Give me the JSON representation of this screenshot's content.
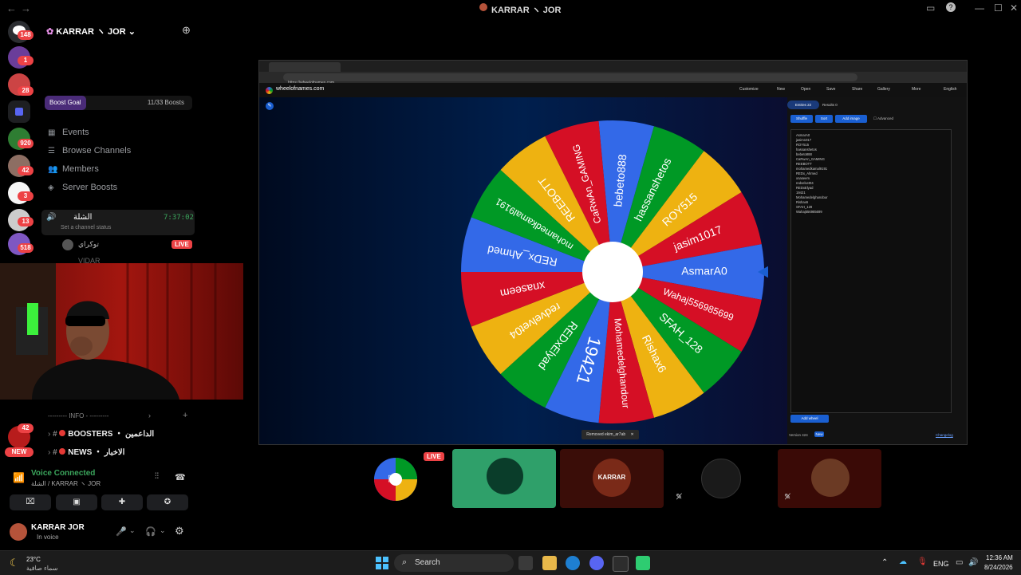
{
  "window": {
    "title": "KARRAR ヽ JOR",
    "back": "←",
    "forward": "→"
  },
  "servers": {
    "badges": [
      "148",
      "1",
      "28",
      "920",
      "42",
      "3",
      "13",
      "518",
      "42"
    ],
    "new_label": "NEW"
  },
  "sidebar": {
    "server_name": "KARRAR ヽ JOR",
    "boost": {
      "label": "Boost Goal",
      "count": "11/33 Boosts"
    },
    "menu": [
      {
        "icon": "calendar-icon",
        "label": "Events"
      },
      {
        "icon": "browse-icon",
        "label": "Browse Channels"
      },
      {
        "icon": "members-icon",
        "label": "Members"
      },
      {
        "icon": "boost-icon",
        "label": "Server Boosts"
      }
    ],
    "voice_channel": {
      "name": "الشلة",
      "timer": "7:37:02",
      "status": "Set a channel status"
    },
    "voice_users": [
      {
        "name": "توكراي",
        "live": "LIVE"
      },
      {
        "name": "VIDAR"
      }
    ],
    "category": "--------- INFO - ---------",
    "channels": [
      {
        "name": "BOOSTERS ・ الداعمين"
      },
      {
        "name": "NEWS ・ الاخبار"
      }
    ]
  },
  "voice_connected": {
    "title": "Voice Connected",
    "subtitle": "الشلة / KARRAR ヽ JOR"
  },
  "user": {
    "name": "KARRAR JOR",
    "status": "In voice"
  },
  "share": {
    "url": "https://wheelofnames.com",
    "site": "wheelofnames.com",
    "toolbar": [
      "Customize",
      "New",
      "Open",
      "Save",
      "Share",
      "Gallery",
      "More",
      "English"
    ],
    "tabs": {
      "entries": "Entries",
      "entries_count": "22",
      "results": "Results",
      "results_count": "0"
    },
    "buttons": {
      "shuffle": "Shuffle",
      "sort": "Sort",
      "add_image": "Add image",
      "advanced": "Advanced",
      "add_wheel": "Add wheel"
    },
    "entries": [
      "AsmarA0",
      "jasim1017",
      "ROY515",
      "hassanshetos",
      "bebeto888",
      "CaRwAn_GAMING",
      "REEBOTT",
      "mohamedkamal9191",
      "REDx_Ahmed",
      "xnaseem",
      "redvelvet04",
      "REDxElyad",
      "19421",
      "Mohamedelghandour",
      "Rishax6",
      "SFAH_128",
      "Wahaj556985699"
    ],
    "version": "Version 424",
    "version_tag": "New",
    "changelog": "Changelog",
    "toast": "Removed ekim_ar7ab",
    "wheel_segments": [
      {
        "label": "bebeto888",
        "color": "#3369e8"
      },
      {
        "label": "hassanshetos",
        "color": "#009925"
      },
      {
        "label": "ROY515",
        "color": "#eeb211"
      },
      {
        "label": "jasim1017",
        "color": "#d50f25"
      },
      {
        "label": "AsmarA0",
        "color": "#3369e8"
      },
      {
        "label": "Wahaj556985699",
        "color": "#d50f25"
      },
      {
        "label": "SFAH_128",
        "color": "#009925"
      },
      {
        "label": "Rishax6",
        "color": "#eeb211"
      },
      {
        "label": "Mohamedelghandour",
        "color": "#d50f25"
      },
      {
        "label": "19421",
        "color": "#3369e8"
      },
      {
        "label": "REDxElyad",
        "color": "#009925"
      },
      {
        "label": "redvelvet04",
        "color": "#eeb211"
      },
      {
        "label": "xnaseem",
        "color": "#d50f25"
      },
      {
        "label": "REDx_Ahmed",
        "color": "#3369e8"
      },
      {
        "label": "mohamedkamal9191",
        "color": "#009925"
      },
      {
        "label": "REEBOTT",
        "color": "#eeb211"
      },
      {
        "label": "CaRwAn_GAMING",
        "color": "#d50f25"
      }
    ]
  },
  "tiles": {
    "live": "LIVE",
    "karrar_logo": "KARRAR"
  },
  "taskbar": {
    "search": "Search",
    "weather_temp": "23°C",
    "weather_desc": "سماء صافية",
    "lang": "ENG",
    "time": "12:36 AM",
    "date": "8/24/2026"
  }
}
